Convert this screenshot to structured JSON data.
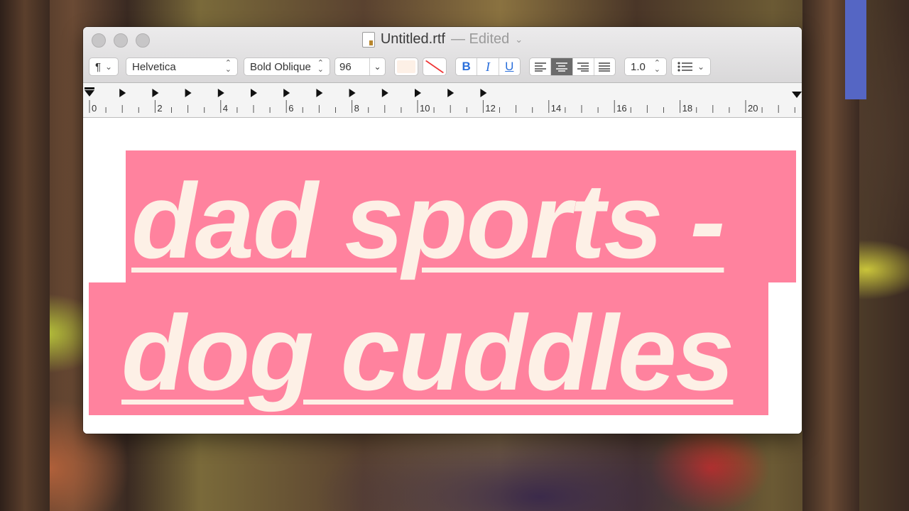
{
  "window": {
    "title": "Untitled.rtf",
    "status": "— Edited",
    "title_chevron": "chevron-down-icon"
  },
  "toolbar": {
    "paragraph_style": "¶",
    "font_family": "Helvetica",
    "typeface": "Bold Oblique",
    "font_size": "96",
    "bold_label": "B",
    "italic_label": "I",
    "underline_label": "U",
    "alignment_selected": "center",
    "line_spacing": "1.0"
  },
  "ruler": {
    "labels": [
      "0",
      "2",
      "4",
      "6",
      "8",
      "10",
      "12",
      "14",
      "16",
      "18",
      "20"
    ]
  },
  "document": {
    "lines": [
      "dad sports -",
      "dog cuddles"
    ],
    "highlight_color": "#ff829e",
    "text_color": "#fdf0e6"
  }
}
